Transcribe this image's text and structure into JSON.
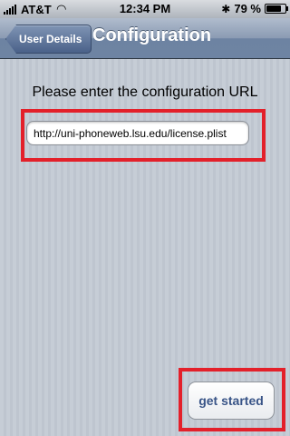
{
  "status_bar": {
    "carrier": "AT&T",
    "time": "12:34 PM",
    "battery": "79 %",
    "battery_level": 0.79,
    "icons": [
      "signal-icon",
      "wifi-icon",
      "bluetooth-icon",
      "battery-icon"
    ]
  },
  "nav": {
    "back_label": "User Details",
    "title": "Configuration"
  },
  "form": {
    "prompt": "Please enter the configuration URL",
    "url_value": "http://uni-phoneweb.lsu.edu/license.plist"
  },
  "actions": {
    "get_started_label": "get started"
  },
  "colors": {
    "highlight": "#e3202a",
    "navbar": "#6e84a3",
    "button_text": "#385487"
  }
}
